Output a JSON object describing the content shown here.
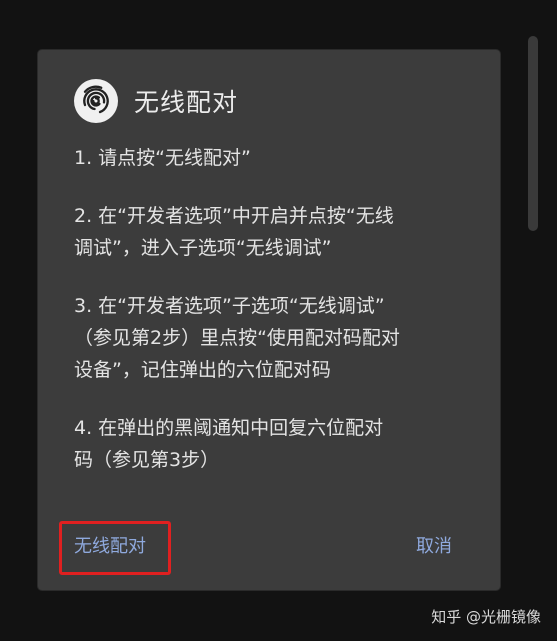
{
  "dialog": {
    "title": "无线配对",
    "app_icon": "swirl-logo-icon",
    "steps": [
      [
        "1. 请点按“无线配对”"
      ],
      [
        "2. 在“开发者选项”中开启并点按“无线",
        "调试”，进入子选项“无线调试”"
      ],
      [
        "3. 在“开发者选项”子选项“无线调试”",
        "（参见第2步）里点按“使用配对码配对",
        "设备”，记住弹出的六位配对码"
      ],
      [
        "4. 在弹出的黑阈通知中回复六位配对",
        "码（参见第3步）"
      ]
    ],
    "buttons": {
      "pair_label": "无线配对",
      "cancel_label": "取消"
    }
  },
  "watermark": "知乎 @光栅镜像",
  "colors": {
    "background": "#121212",
    "dialog_background": "#3c3c3c",
    "button_text": "#8fa9dd",
    "highlight_border": "#e02020"
  }
}
